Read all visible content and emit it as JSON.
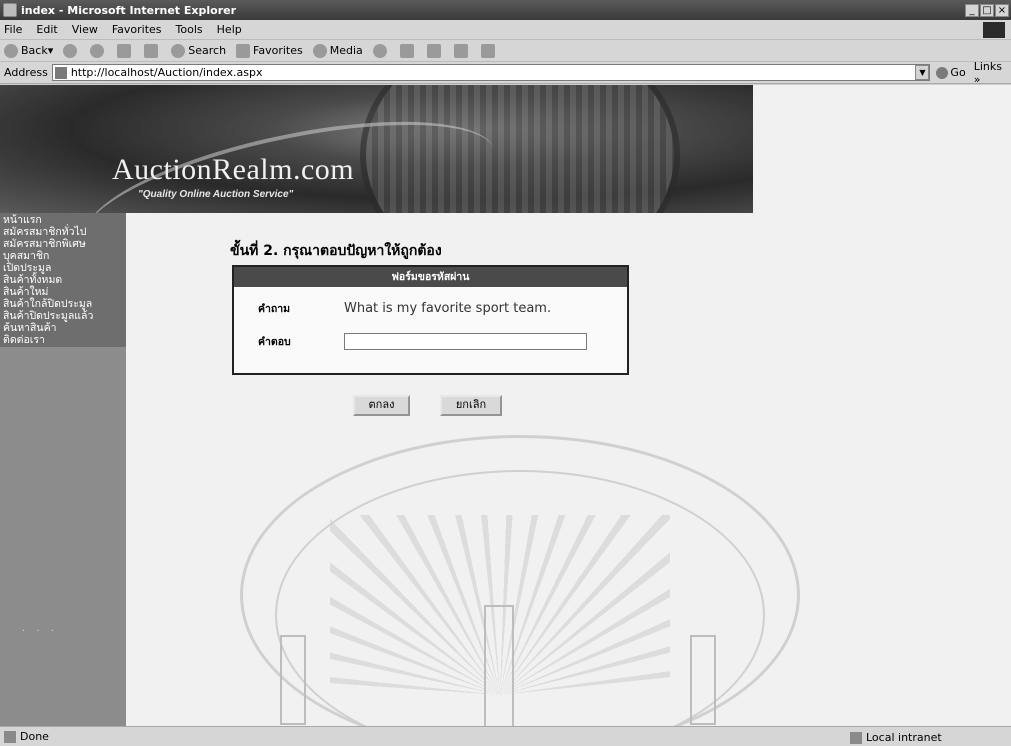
{
  "window": {
    "title": "index - Microsoft Internet Explorer",
    "buttons": [
      "_",
      "□",
      "×"
    ]
  },
  "menu": [
    "File",
    "Edit",
    "View",
    "Favorites",
    "Tools",
    "Help"
  ],
  "toolbar": {
    "back": "Back",
    "search": "Search",
    "favorites": "Favorites",
    "media": "Media"
  },
  "address": {
    "label": "Address",
    "url": "http://localhost/Auction/index.aspx",
    "go": "Go",
    "links": "Links »"
  },
  "banner": {
    "brand": "AuctionRealm.com",
    "tagline": "\"Quality Online Auction Service\""
  },
  "sidebar": {
    "items": [
      "หน้าแรก",
      "สมัครสมาชิกทั่วไป",
      "สมัครสมาชิกพิเศษ",
      "บุคสมาชิก",
      "เปิดประมูล",
      "สินค้าทั้งหมด",
      "สินค้าใหม่",
      "สินค้าใกล้ปิดประมูล",
      "สินค้าปิดประมูลแล้ว",
      "ค้นหาสินค้า",
      "ติดต่อเรา"
    ],
    "footer": "· · ·"
  },
  "main": {
    "heading": "ขั้นที่ 2. กรุณาตอบปัญหาให้ถูกต้อง",
    "form": {
      "header": "ฟอร์มขอรหัสผ่าน",
      "question_label": "คำถาม",
      "question": "What is my favorite sport team.",
      "answer_label": "คำตอบ",
      "answer_value": ""
    },
    "ok_label": "ตกลง",
    "cancel_label": "ยกเลิก"
  },
  "status": {
    "left": "Done",
    "right": "Local intranet"
  }
}
